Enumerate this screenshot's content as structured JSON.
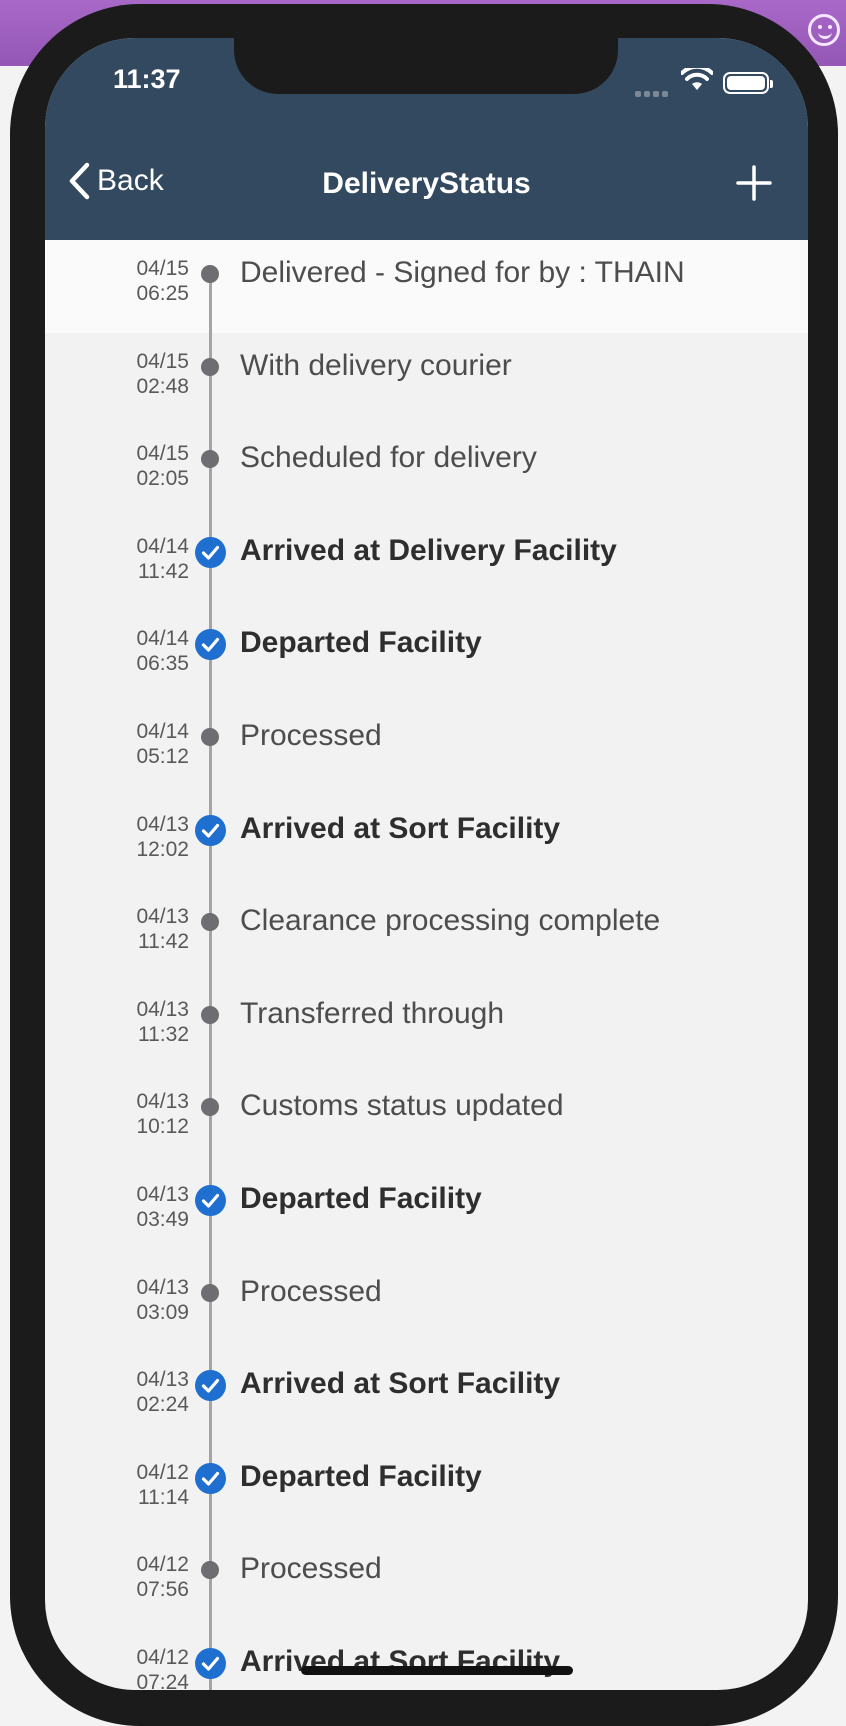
{
  "status_bar": {
    "time": "11:37"
  },
  "nav": {
    "back_label": "Back",
    "title": "DeliveryStatus",
    "add_icon": "plus-icon",
    "back_icon": "chevron-left-icon"
  },
  "colors": {
    "nav_bar": "#334960",
    "check_blue": "#1f6fd0",
    "dot_gray": "#6d6d72",
    "background": "#f2f2f2"
  },
  "events": [
    {
      "date": "04/15",
      "time": "06:25",
      "label": "Delivered - Signed for by : THAIN",
      "milestone": false
    },
    {
      "date": "04/15",
      "time": "02:48",
      "label": "With delivery courier",
      "milestone": false
    },
    {
      "date": "04/15",
      "time": "02:05",
      "label": "Scheduled for delivery",
      "milestone": false
    },
    {
      "date": "04/14",
      "time": "11:42",
      "label": "Arrived at Delivery Facility",
      "milestone": true
    },
    {
      "date": "04/14",
      "time": "06:35",
      "label": "Departed Facility",
      "milestone": true
    },
    {
      "date": "04/14",
      "time": "05:12",
      "label": "Processed",
      "milestone": false
    },
    {
      "date": "04/13",
      "time": "12:02",
      "label": "Arrived at Sort Facility",
      "milestone": true
    },
    {
      "date": "04/13",
      "time": "11:42",
      "label": "Clearance processing complete",
      "milestone": false
    },
    {
      "date": "04/13",
      "time": "11:32",
      "label": "Transferred through",
      "milestone": false
    },
    {
      "date": "04/13",
      "time": "10:12",
      "label": "Customs status updated",
      "milestone": false
    },
    {
      "date": "04/13",
      "time": "03:49",
      "label": "Departed Facility",
      "milestone": true
    },
    {
      "date": "04/13",
      "time": "03:09",
      "label": "Processed",
      "milestone": false
    },
    {
      "date": "04/13",
      "time": "02:24",
      "label": "Arrived at Sort Facility",
      "milestone": true
    },
    {
      "date": "04/12",
      "time": "11:14",
      "label": "Departed Facility",
      "milestone": true
    },
    {
      "date": "04/12",
      "time": "07:56",
      "label": "Processed",
      "milestone": false
    },
    {
      "date": "04/12",
      "time": "07:24",
      "label": "Arrived at Sort Facility",
      "milestone": true
    }
  ]
}
